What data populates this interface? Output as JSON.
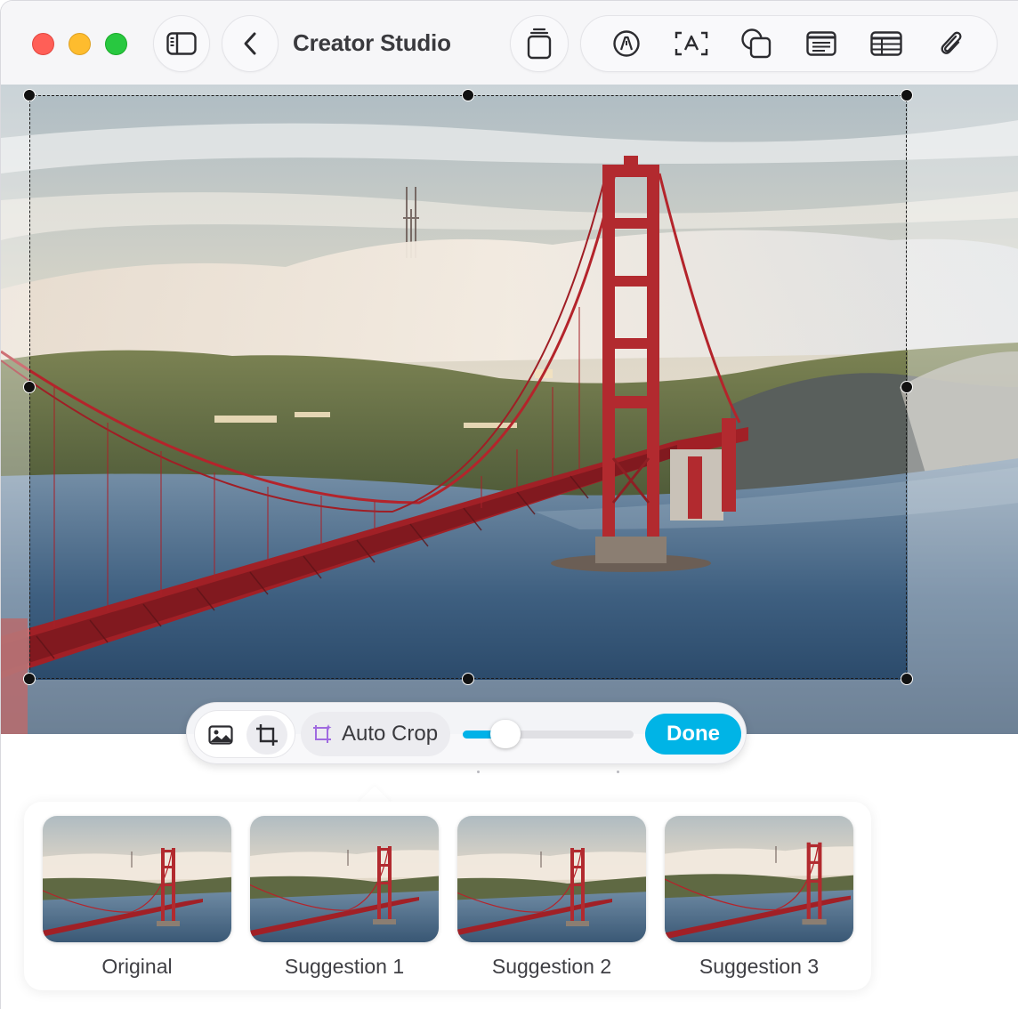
{
  "app": {
    "title": "Creator Studio"
  },
  "toolbar": {
    "sidebar_icon": "sidebar-toggle-icon",
    "back_icon": "chevron-left-icon",
    "stack_icon": "pages-stack-icon",
    "tools": [
      {
        "name": "pen-tool-icon"
      },
      {
        "name": "text-box-icon"
      },
      {
        "name": "shapes-icon"
      },
      {
        "name": "text-block-icon"
      },
      {
        "name": "table-icon"
      },
      {
        "name": "paperclip-icon"
      }
    ]
  },
  "crop_bar": {
    "photo_icon": "photo-icon",
    "crop_icon": "crop-icon",
    "auto_crop_label": "Auto Crop",
    "slider_value": 0.25,
    "done_label": "Done"
  },
  "suggestions": [
    {
      "label": "Original"
    },
    {
      "label": "Suggestion 1"
    },
    {
      "label": "Suggestion 2"
    },
    {
      "label": "Suggestion 3"
    }
  ],
  "colors": {
    "accent": "#00b4e6",
    "bridge": "#b4242b",
    "close": "#ff5f57",
    "minimize": "#febc2e",
    "zoom": "#28c840"
  }
}
